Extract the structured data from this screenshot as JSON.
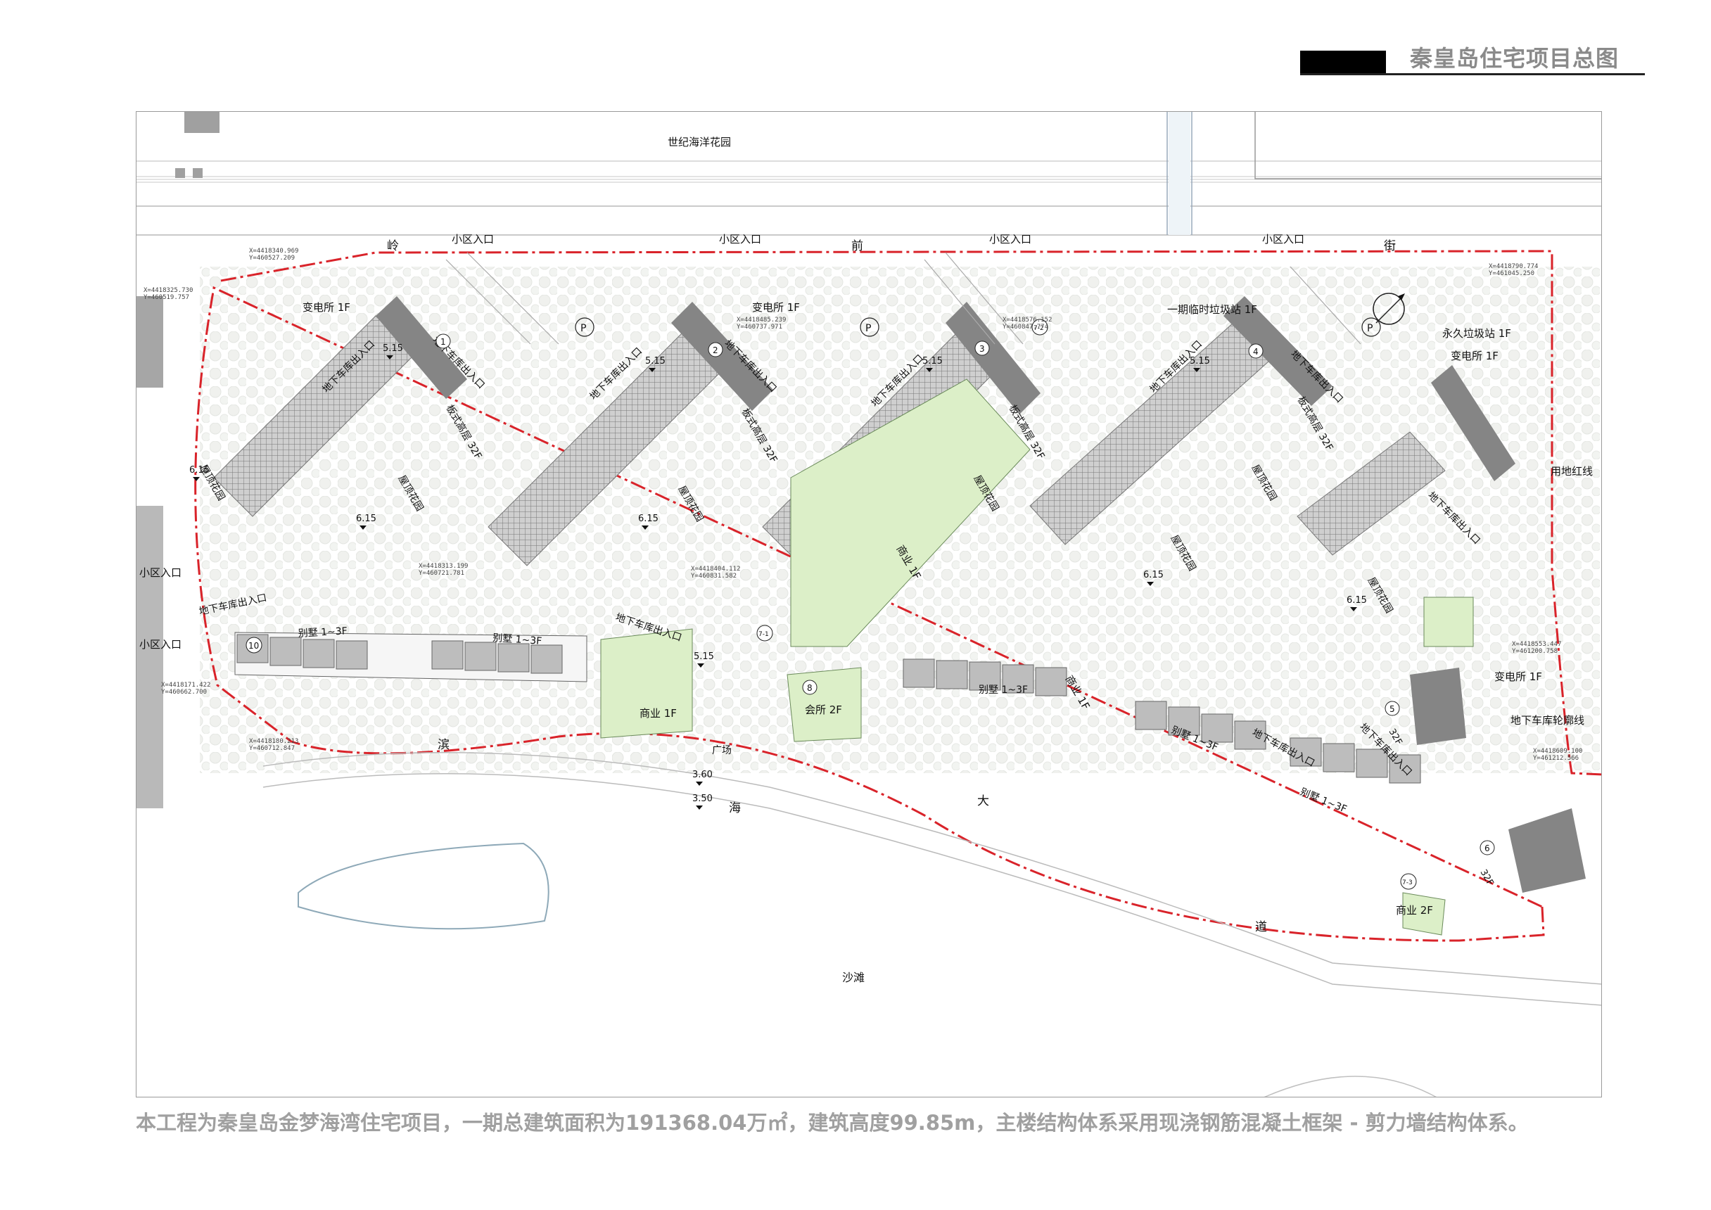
{
  "header": {
    "title": "秦皇岛住宅项目总图"
  },
  "caption": "本工程为秦皇岛金梦海湾住宅项目，一期总建筑面积为191368.04万㎡，建筑高度99.85m，主楼结构体系采用现浇钢筋混凝土框架 - 剪力墙结构体系。",
  "colors": {
    "red_line": "#d9232a",
    "green_fill": "#dcefc8",
    "tower_gray": "#858585",
    "accent_text": "#8a8a8a"
  },
  "plan": {
    "north_garden": "世纪海洋花园",
    "road_north": [
      "岭",
      "前",
      "街"
    ],
    "road_south": [
      "滨",
      "海",
      "大",
      "道"
    ],
    "beach": "沙滩",
    "entrances": [
      "小区入口",
      "小区入口",
      "小区入口",
      "小区入口",
      "小区入口",
      "小区入口"
    ],
    "substations": [
      "变电所 1F",
      "变电所 1F",
      "变电所 1F",
      "变电所 1F"
    ],
    "trash": [
      "一期临时垃圾站 1F",
      "永久垃圾站 1F"
    ],
    "red_line_label": "用地红线",
    "garage_outline": "地下车库轮廓线",
    "garage_entrance": "地下车库出入口",
    "tower_type": "板式高层 32F",
    "roof_garden": "屋顶花园",
    "villa": "别墅 1~3F",
    "commercial_1f": "商业 1F",
    "commercial_2f": "商业 2F",
    "clubhouse": "会所 2F",
    "plaza": "广场",
    "tower_32f": "32F",
    "parking_symbol": "P",
    "elevations": [
      "5.15",
      "5.15",
      "5.15",
      "5.15",
      "5.15",
      "6.15",
      "6.15",
      "6.15",
      "6.15",
      "6.15",
      "3.60",
      "3.50"
    ],
    "building_numbers": [
      "1",
      "2",
      "3",
      "4",
      "5",
      "6",
      "8",
      "10",
      "7-1",
      "7-2",
      "7-3"
    ],
    "coordinates": [
      "X=4418340.969",
      "Y=460527.209",
      "X=4418325.730",
      "Y=460519.757",
      "X=4418485.239",
      "Y=460737.971",
      "X=4418576.152",
      "Y=460847.774",
      "X=4418790.774",
      "Y=461045.250",
      "X=4418313.199",
      "Y=460721.781",
      "X=4418404.112",
      "Y=460831.582",
      "X=4418171.422",
      "Y=460662.700",
      "X=4418180.213",
      "Y=460712.847",
      "X=4418553.447",
      "Y=461200.758",
      "X=4418609.100",
      "Y=461212.566"
    ]
  }
}
